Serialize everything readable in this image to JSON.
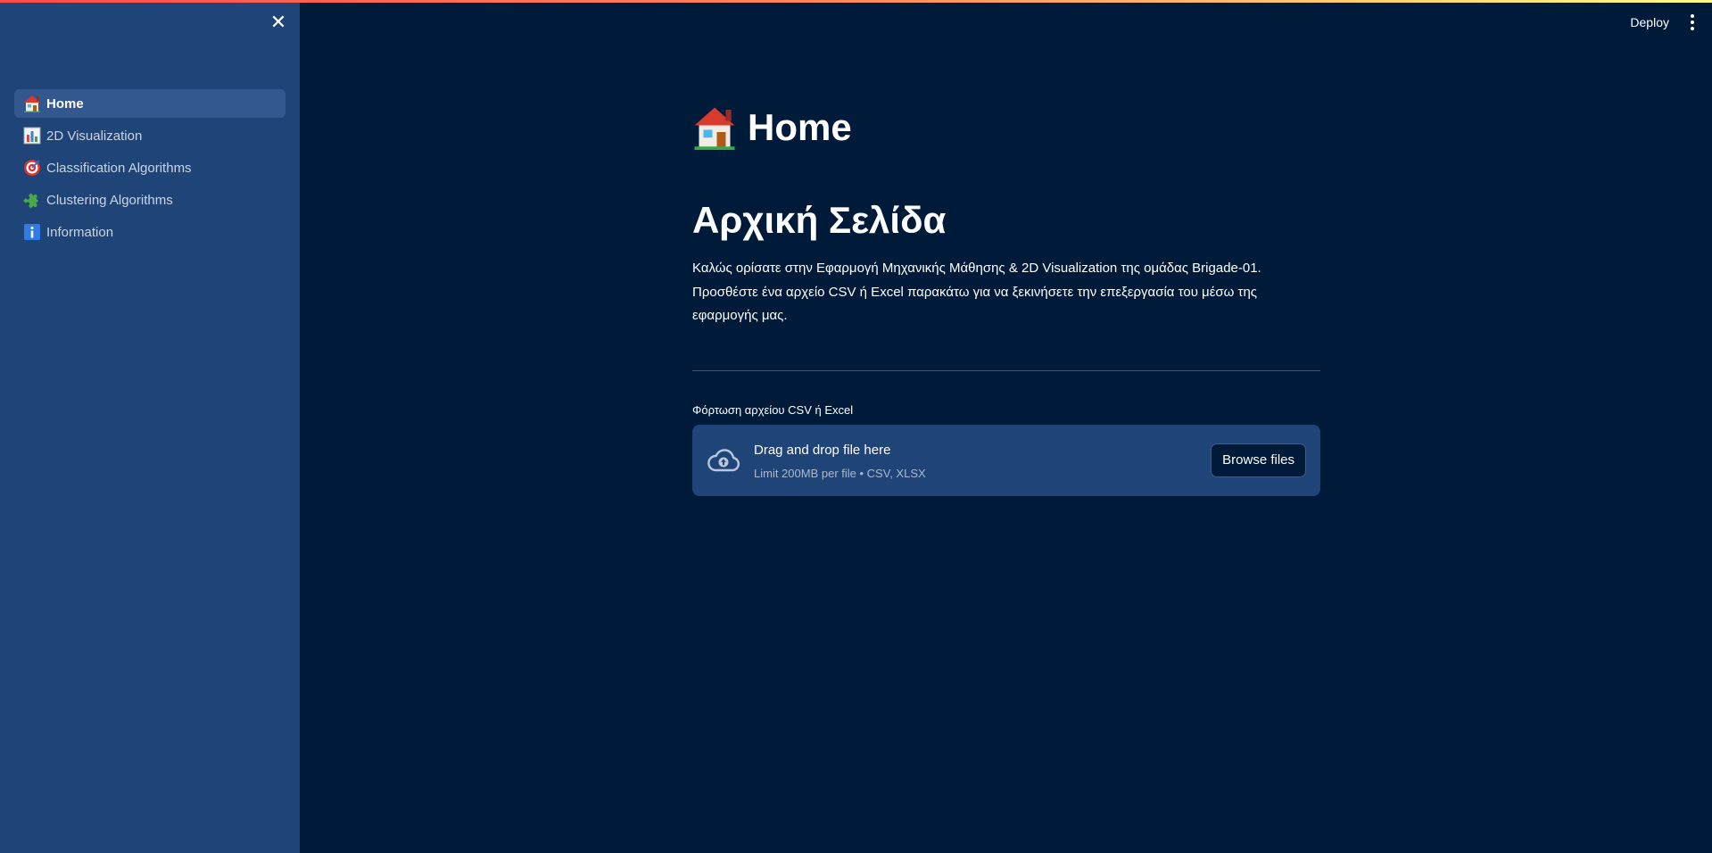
{
  "sidebar": {
    "close_label": "✕",
    "items": [
      {
        "label": "Home",
        "icon": "house-icon",
        "active": true
      },
      {
        "label": "2D Visualization",
        "icon": "bar-chart-icon",
        "active": false
      },
      {
        "label": "Classification Algorithms",
        "icon": "target-icon",
        "active": false
      },
      {
        "label": "Clustering Algorithms",
        "icon": "puzzle-icon",
        "active": false
      },
      {
        "label": "Information",
        "icon": "info-icon",
        "active": false
      }
    ]
  },
  "header": {
    "deploy_label": "Deploy",
    "menu_icon": "kebab-menu-icon"
  },
  "main": {
    "page_title": "Home",
    "page_title_icon": "house-icon",
    "section_title": "Αρχική Σελίδα",
    "intro_lines": [
      "Καλώς ορίσατε στην Εφαρμογή Μηχανικής Μάθησης & 2D Visualization της ομάδας Brigade-01.",
      "Προσθέστε ένα αρχείο CSV ή Excel παρακάτω για να ξεκινήσετε την επεξεργασία του μέσω της",
      "εφαρμογής μας."
    ],
    "upload": {
      "label": "Φόρτωση αρχείου CSV ή Excel",
      "drop_title": "Drag and drop file here",
      "drop_subtitle": "Limit 200MB per file • CSV, XLSX",
      "browse_label": "Browse files",
      "icon": "cloud-upload-icon"
    }
  },
  "colors": {
    "sidebar_bg": "#1f4478",
    "main_bg": "#001a3a",
    "active_item_bg": "#33588f",
    "dropzone_bg": "#1f4478"
  }
}
